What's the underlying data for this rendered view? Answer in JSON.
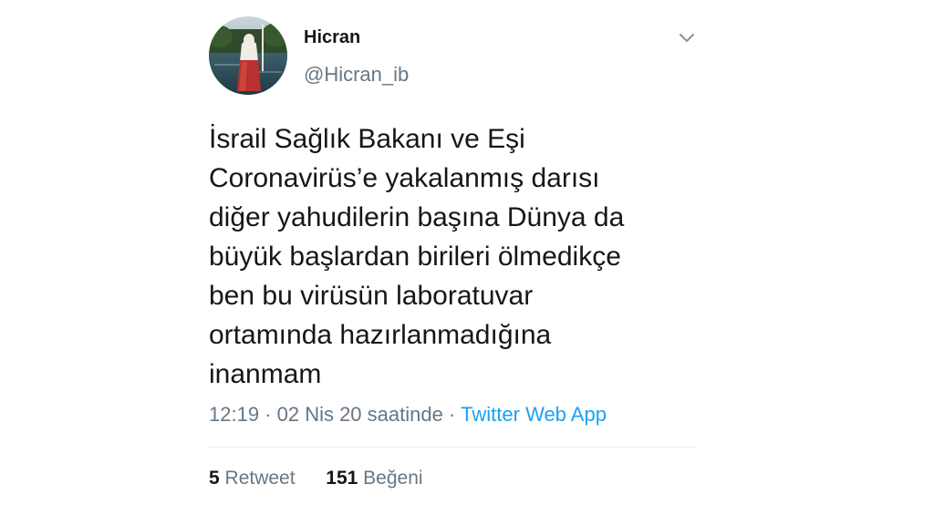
{
  "tweet": {
    "author": {
      "display_name": "Hicran",
      "handle": "@Hicran_ib",
      "avatar_icon": "profile-photo"
    },
    "menu_icon": "chevron-down-icon",
    "text": "İsrail Sağlık Bakanı ve Eşi\nCoronavirüs’e yakalanmış darısı\ndiğer yahudilerin başına Dünya da\nbüyük başlardan birileri ölmedikçe\nben bu virüsün laboratuvar\nortamında hazırlanmadığına\ninanmam",
    "timestamp": "12:19 · 02 Nis 20 saatinde",
    "separator": "·",
    "source": "Twitter Web App",
    "stats": {
      "retweet_count": "5",
      "retweet_label": "Retweet",
      "like_count": "151",
      "like_label": "Beğeni"
    }
  },
  "colors": {
    "text_primary": "#14171a",
    "text_secondary": "#657786",
    "link": "#1da1f2",
    "divider": "#e6ecf0"
  }
}
